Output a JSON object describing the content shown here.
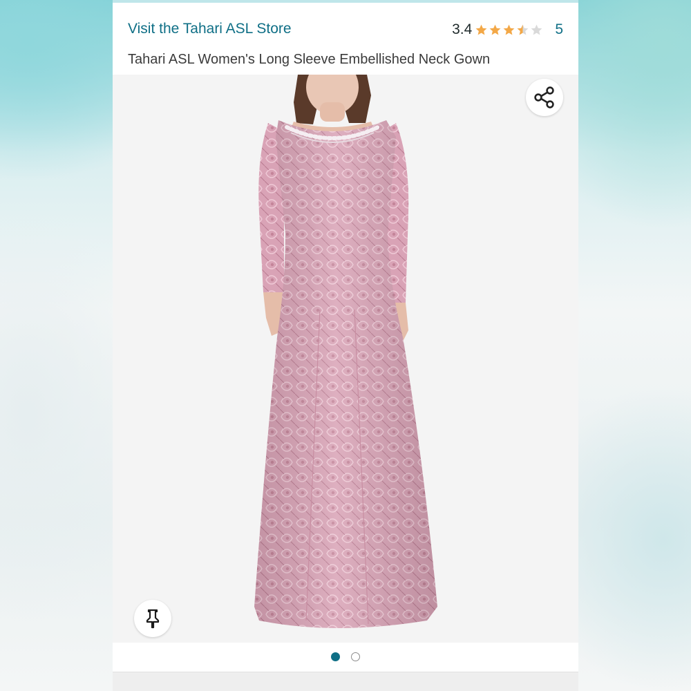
{
  "header": {
    "store_link": "Visit the Tahari ASL Store",
    "rating_value": "3.4",
    "rating_stars": 3.4,
    "rating_count": "5",
    "product_title": "Tahari ASL Women's Long Sleeve Embellished Neck Gown"
  },
  "gallery": {
    "image_alt": "Tahari ASL Women's Long Sleeve Embellished Neck Gown",
    "slides": [
      "active",
      "inactive"
    ],
    "share_icon": "share-icon",
    "pin_icon": "pushpin-icon"
  },
  "colors": {
    "link": "#0f6f86",
    "star": "#f3a847",
    "gown": "#d79fb2",
    "active_dot": "#0f6f86"
  }
}
